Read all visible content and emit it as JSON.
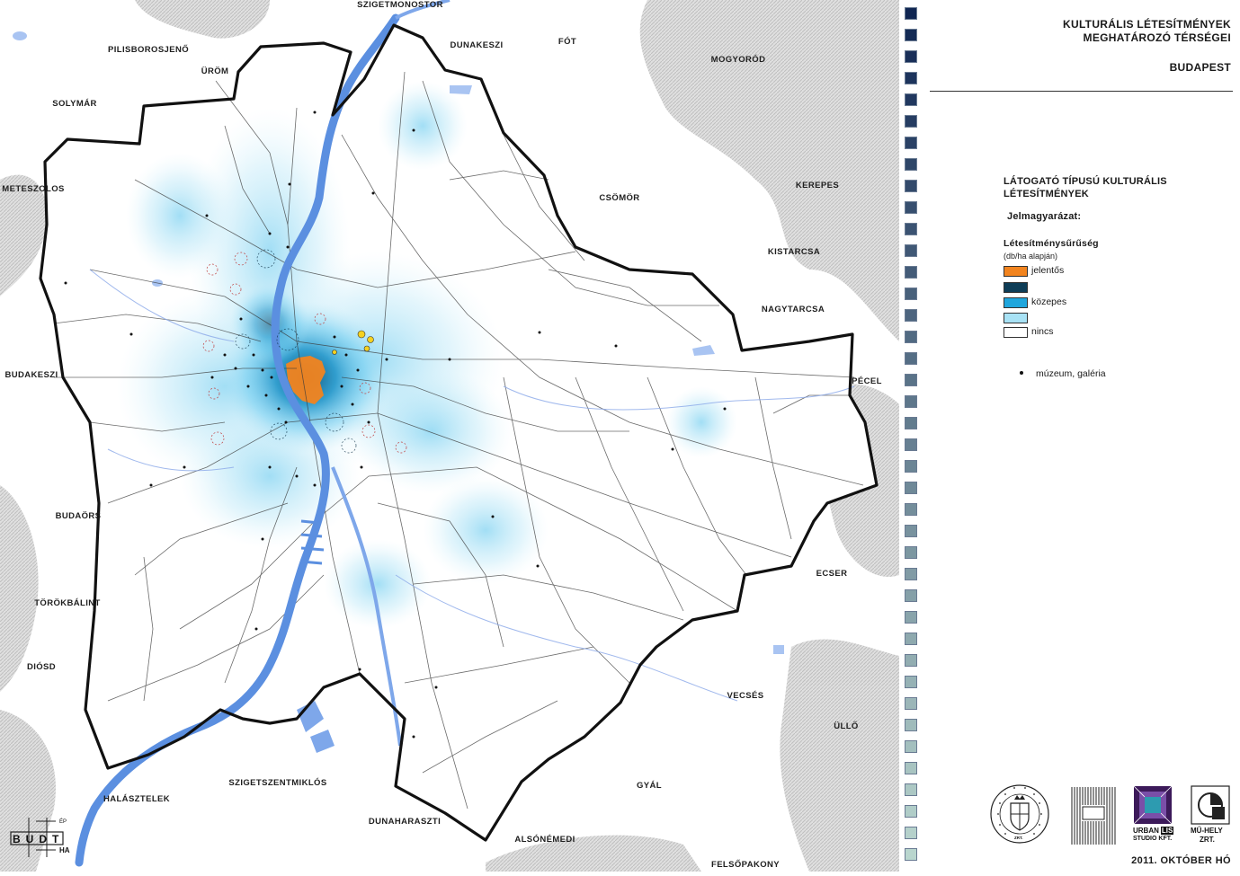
{
  "title": {
    "line1": "KULTURÁLIS LÉTESÍTMÉNYEK",
    "line2": "MEGHATÁROZÓ TÉRSÉGEI",
    "city": "BUDAPEST"
  },
  "legend": {
    "heading_line1": "LÁTOGATÓ TÍPUSÚ KULTURÁLIS",
    "heading_line2": "LÉTESÍTMÉNYEK",
    "key_title": "Jelmagyarázat:",
    "density_title": "Létesítménysűrűség",
    "density_unit": "(db/ha alapján)",
    "classes": [
      {
        "label": "jelentős",
        "color": "#f2841f"
      },
      {
        "label": "",
        "color": "#0e3d57"
      },
      {
        "label": "közepes",
        "color": "#1fa6dd"
      },
      {
        "label": "",
        "color": "#a8e2f5"
      },
      {
        "label": "nincs",
        "color": "#ffffff"
      }
    ],
    "point_label": "múzeum, galéria"
  },
  "places": {
    "szigetmonostor": "SZIGETMONOSTOR",
    "pilisborosjeno": "PILISBOROSJENŐ",
    "urom": "ÜRÖM",
    "dunakeszi": "DUNAKESZI",
    "fot": "FÓT",
    "mogyorod": "MOGYORÓD",
    "solymar": "SOLYMÁR",
    "meteszolos": "METESZOLOS",
    "csomor": "CSÖMÖR",
    "kerepes": "KEREPES",
    "kistarcsa": "KISTARCSA",
    "nagytarcsa": "NAGYTARCSA",
    "budakeszi": "BUDAKESZI",
    "pecel": "PÉCEL",
    "budaors": "BUDAÖRS",
    "ecser": "ECSER",
    "torokbalint": "TÖRÖKBÁLINT",
    "diosd": "DIÓSD",
    "vecses": "VECSÉS",
    "ullo": "ÜLLŐ",
    "halaszt": "HALÁSZTELEK",
    "szigetszentmiklos": "SZIGETSZENTMIKLÓS",
    "gyal": "GYÁL",
    "dunaharaszti": "DUNAHARASZTI",
    "alsonemedi": "ALSÓNÉMEDI",
    "felsopakony": "FELSŐPAKONY"
  },
  "logos": {
    "budt": "BUDT",
    "budt_sub1": "ÉP",
    "budt_sub2": "HA",
    "cert_text": "ZRT.",
    "urban_line1": "URBAN",
    "urban_mark": "LIS",
    "urban_line2": "STUDIO KFT.",
    "muhely_line1": "MŰ-HELY",
    "muhely_line2": "ZRT."
  },
  "date": "2011. OKTÓBER HÓ",
  "colors": {
    "river": "#5b8fe0",
    "water_light": "#a9c4f2",
    "boundary": "#111111",
    "street": "#3a3a3a",
    "woodland": "#c8c8c8",
    "density_core": "#f2841f",
    "density_dark": "#0e3d57",
    "density_mid": "#1fa6dd",
    "density_light": "#bfe9f8"
  }
}
